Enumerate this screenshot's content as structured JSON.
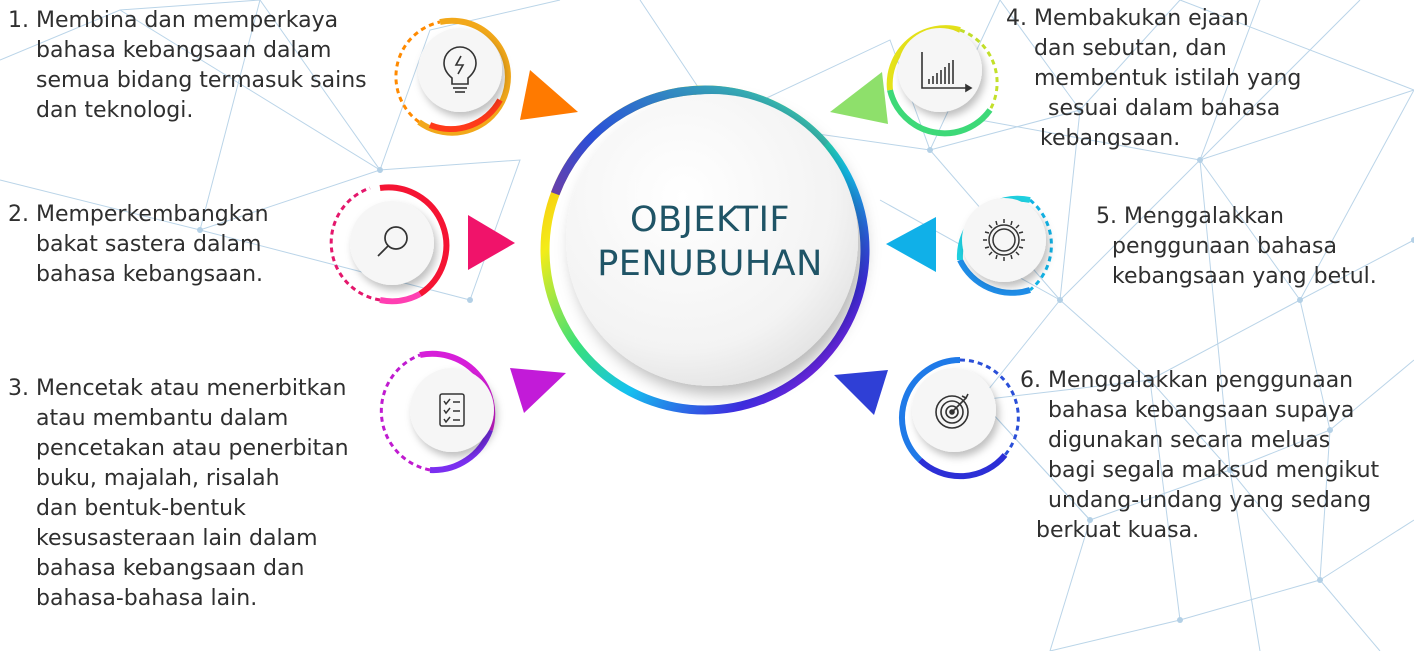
{
  "center": {
    "title_lines": [
      "OBJEKTIF",
      "PENUBUHAN"
    ]
  },
  "items": [
    {
      "number": 1,
      "icon": "lightbulb-icon",
      "color": "#f5a000",
      "lines": [
        "1. Membina dan memperkaya",
        "bahasa kebangsaan dalam",
        "semua bidang termasuk sains",
        "dan teknologi."
      ]
    },
    {
      "number": 2,
      "icon": "magnifier-icon",
      "color": "#e8175d",
      "lines": [
        "2. Memperkembangkan",
        "bakat sastera dalam",
        "bahasa kebangsaan."
      ]
    },
    {
      "number": 3,
      "icon": "checklist-icon",
      "color": "#b41fd6",
      "lines": [
        "3. Mencetak atau menerbitkan",
        "atau membantu dalam",
        "pencetakan atau penerbitan",
        "buku, majalah, risalah",
        "dan bentuk-bentuk",
        "kesusasteraan lain dalam",
        "bahasa kebangsaan dan",
        "bahasa-bahasa lain."
      ]
    },
    {
      "number": 4,
      "icon": "bar-chart-icon",
      "color": "#7bd95a",
      "lines": [
        "4. Membakukan ejaan",
        "dan sebutan, dan",
        "membentuk istilah yang",
        "sesuai dalam bahasa",
        "kebangsaan."
      ]
    },
    {
      "number": 5,
      "icon": "sun-gear-icon",
      "color": "#12b3e6",
      "lines": [
        "5. Menggalakkan",
        "penggunaan bahasa",
        "kebangsaan yang betul."
      ]
    },
    {
      "number": 6,
      "icon": "target-icon",
      "color": "#2a4fd8",
      "lines": [
        "6. Menggalakkan penggunaan",
        "bahasa kebangsaan supaya",
        "digunakan secara meluas",
        "bagi segala maksud mengikut",
        "undang-undang yang sedang",
        "berkuat kuasa."
      ]
    }
  ],
  "colors": {
    "text": "#2f2f2f",
    "center_title": "#1f5466",
    "network_lines": "#a9c9e0"
  }
}
